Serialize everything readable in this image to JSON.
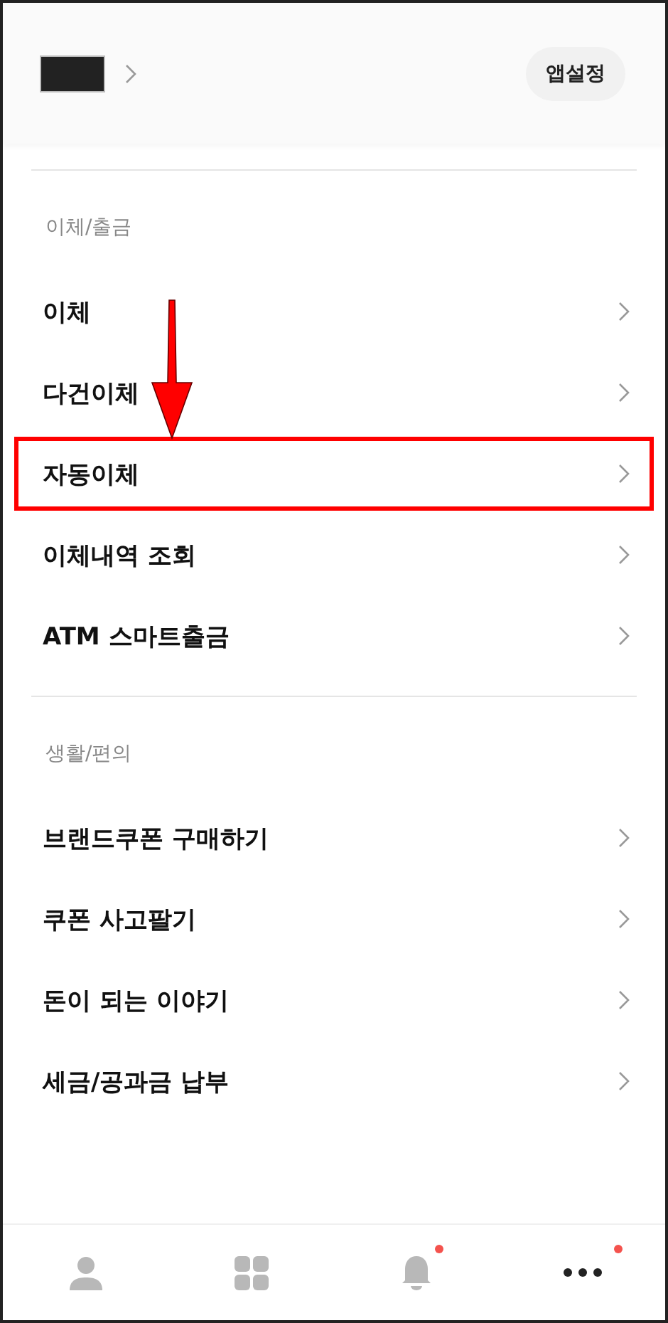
{
  "header": {
    "settings_button": "앱설정"
  },
  "sections": [
    {
      "title": "이체/출금",
      "items": [
        {
          "label": "이체",
          "highlighted": false
        },
        {
          "label": "다건이체",
          "highlighted": false
        },
        {
          "label": "자동이체",
          "highlighted": true
        },
        {
          "label": "이체내역 조회",
          "highlighted": false
        },
        {
          "label": "ATM 스마트출금",
          "highlighted": false
        }
      ]
    },
    {
      "title": "생활/편의",
      "items": [
        {
          "label": "브랜드쿠폰 구매하기",
          "highlighted": false
        },
        {
          "label": "쿠폰 사고팔기",
          "highlighted": false
        },
        {
          "label": "돈이 되는 이야기",
          "highlighted": false
        },
        {
          "label": "세금/공과금 납부",
          "highlighted": false
        }
      ]
    }
  ],
  "bottom_nav": [
    {
      "kind": "person",
      "selected": false,
      "badge": false
    },
    {
      "kind": "grid",
      "selected": false,
      "badge": false
    },
    {
      "kind": "bell",
      "selected": false,
      "badge": true
    },
    {
      "kind": "more",
      "selected": true,
      "badge": true
    }
  ]
}
